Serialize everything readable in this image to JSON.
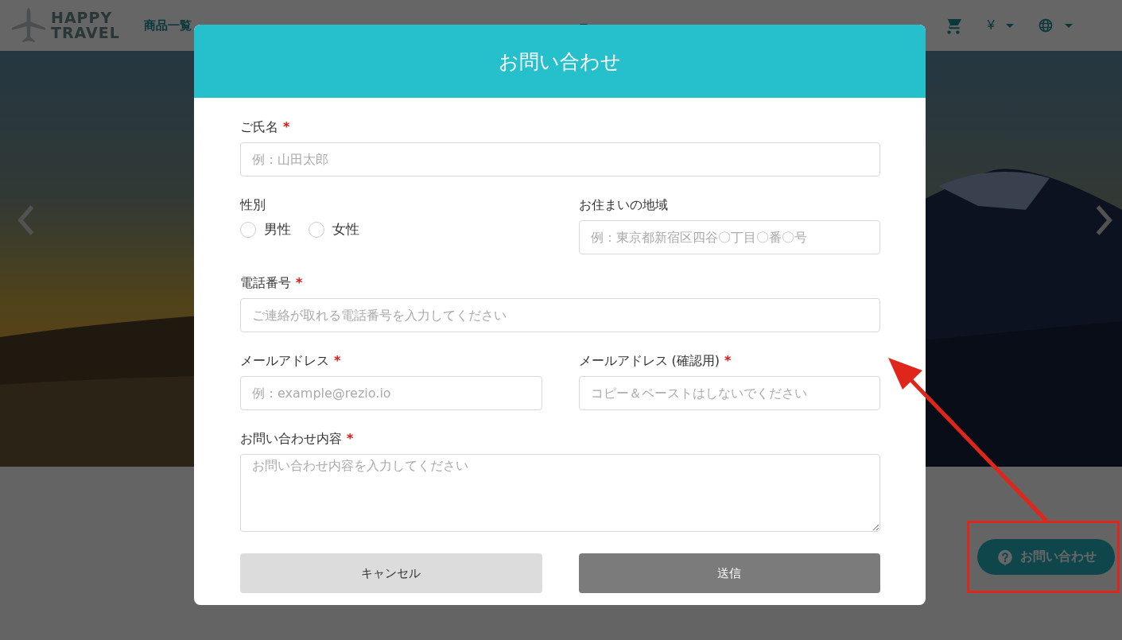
{
  "header": {
    "logo_lines": [
      "HAPPY",
      "TRAVEL"
    ],
    "nav": [
      "商品一覧"
    ],
    "currency": "¥"
  },
  "modal": {
    "title": "お問い合わせ",
    "required_mark": "*",
    "rows": [
      [
        {
          "kind": "text",
          "label": "ご氏名",
          "required": true,
          "placeholder": "例：山田太郎"
        }
      ],
      [
        {
          "kind": "radio",
          "label": "性別",
          "required": false,
          "options": [
            {
              "label": "男性",
              "selected": false
            },
            {
              "label": "女性",
              "selected": false
            }
          ]
        },
        {
          "kind": "text",
          "label": "お住まいの地域",
          "required": false,
          "placeholder": "例：東京都新宿区四谷〇丁目〇番〇号"
        }
      ],
      [
        {
          "kind": "text",
          "label": "電話番号",
          "required": true,
          "placeholder": "ご連絡が取れる電話番号を入力してください"
        }
      ],
      [
        {
          "kind": "text",
          "label": "メールアドレス",
          "required": true,
          "placeholder": "例：example@rezio.io"
        },
        {
          "kind": "text",
          "label": "メールアドレス (確認用)",
          "required": true,
          "placeholder": "コピー＆ペーストはしないでください"
        }
      ],
      [
        {
          "kind": "textarea",
          "label": "お問い合わせ内容",
          "required": true,
          "placeholder": "お問い合わせ内容を入力してください"
        }
      ]
    ],
    "buttons": [
      {
        "kind": "secondary",
        "label": "キャンセル"
      },
      {
        "kind": "primary",
        "label": "送信"
      }
    ]
  },
  "floating_button": {
    "label": "お問い合わせ"
  }
}
